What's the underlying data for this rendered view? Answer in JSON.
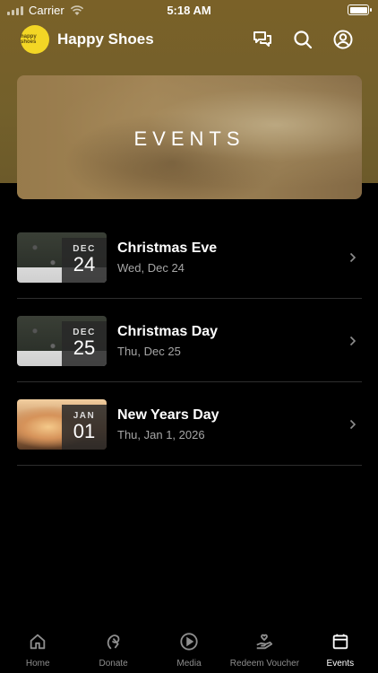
{
  "status_bar": {
    "carrier": "Carrier",
    "time": "5:18 AM"
  },
  "header": {
    "logo_text": "happy shoes",
    "title": "Happy Shoes",
    "icons": [
      "chat-icon",
      "search-icon",
      "account-icon"
    ]
  },
  "banner": {
    "title": "EVENTS"
  },
  "events": [
    {
      "month": "DEC",
      "day": "24",
      "name": "Christmas Eve",
      "date": "Wed, Dec 24",
      "thumb": "winter"
    },
    {
      "month": "DEC",
      "day": "25",
      "name": "Christmas Day",
      "date": "Thu, Dec 25",
      "thumb": "winter"
    },
    {
      "month": "JAN",
      "day": "01",
      "name": "New Years Day",
      "date": "Thu, Jan 1, 2026",
      "thumb": "sunset"
    }
  ],
  "tabbar": {
    "tabs": [
      {
        "label": "Home",
        "icon": "home-icon",
        "active": false
      },
      {
        "label": "Donate",
        "icon": "donate-icon",
        "active": false
      },
      {
        "label": "Media",
        "icon": "play-icon",
        "active": false
      },
      {
        "label": "Redeem Voucher",
        "icon": "hand-heart-icon",
        "active": false
      },
      {
        "label": "Events",
        "icon": "calendar-icon",
        "active": true
      }
    ]
  },
  "colors": {
    "accent": "#f3d625",
    "header_bg": "#7a6128",
    "background": "#000000",
    "muted_text": "#a6a6a6"
  }
}
